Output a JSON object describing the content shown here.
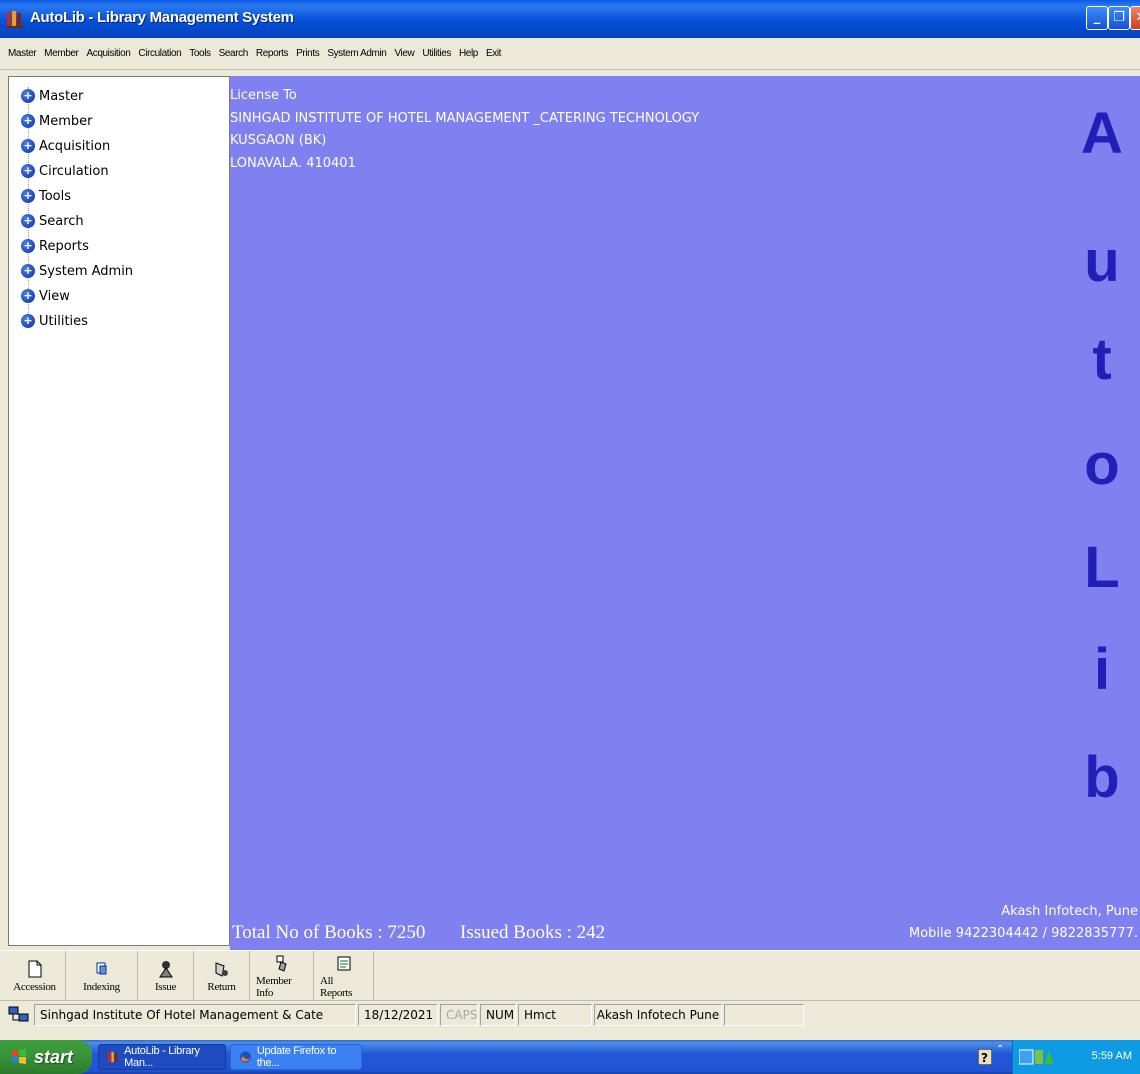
{
  "window": {
    "title": "AutoLib - Library Management System"
  },
  "menu": [
    "Master",
    "Member",
    "Acquisition",
    "Circulation",
    "Tools",
    "Search",
    "Reports",
    "Prints",
    "System Admin",
    "View",
    "Utilities",
    "Help",
    "Exit"
  ],
  "tree": [
    "Master",
    "Member",
    "Acquisition",
    "Circulation",
    "Tools",
    "Search",
    "Reports",
    "System Admin",
    "View",
    "Utilities"
  ],
  "license": {
    "heading": "License To",
    "line1": "SINHGAD INSTITUTE OF HOTEL MANAGEMENT _CATERING TECHNOLOGY",
    "line2": "KUSGAON (BK)",
    "line3": "LONAVALA. 410401"
  },
  "banner_letters": [
    "A",
    "u",
    "t",
    "o",
    "L",
    "i",
    "b"
  ],
  "stats": {
    "total_books": "Total No of Books : 7250",
    "issued_books": "Issued Books : 242"
  },
  "vendor": {
    "company": "Akash Infotech, Pune",
    "mobile": "Mobile 9422304442 / 9822835777."
  },
  "toolbar": [
    {
      "label": "Accession",
      "icon": "document-icon"
    },
    {
      "label": "Indexing",
      "icon": "indexing-icon"
    },
    {
      "label": "Issue",
      "icon": "issue-icon"
    },
    {
      "label": "Return",
      "icon": "return-icon"
    },
    {
      "label": "Member Info",
      "icon": "member-info-icon"
    },
    {
      "label": "All Reports",
      "icon": "reports-icon"
    }
  ],
  "status": {
    "institute": "Sinhgad Institute Of Hotel Management & Cate",
    "date": "18/12/2021",
    "caps": "CAPS",
    "num": "NUM",
    "user": "Hmct",
    "vendor": "Akash Infotech Pune"
  },
  "taskbar": {
    "start": "start",
    "task1": "AutoLib - Library Man...",
    "task2": "Update Firefox to the...",
    "clock": "5:59 AM"
  },
  "colors": {
    "main_bg": "#8080f0",
    "banner_letter": "#2020b8",
    "title_bar": "#0550d8"
  }
}
